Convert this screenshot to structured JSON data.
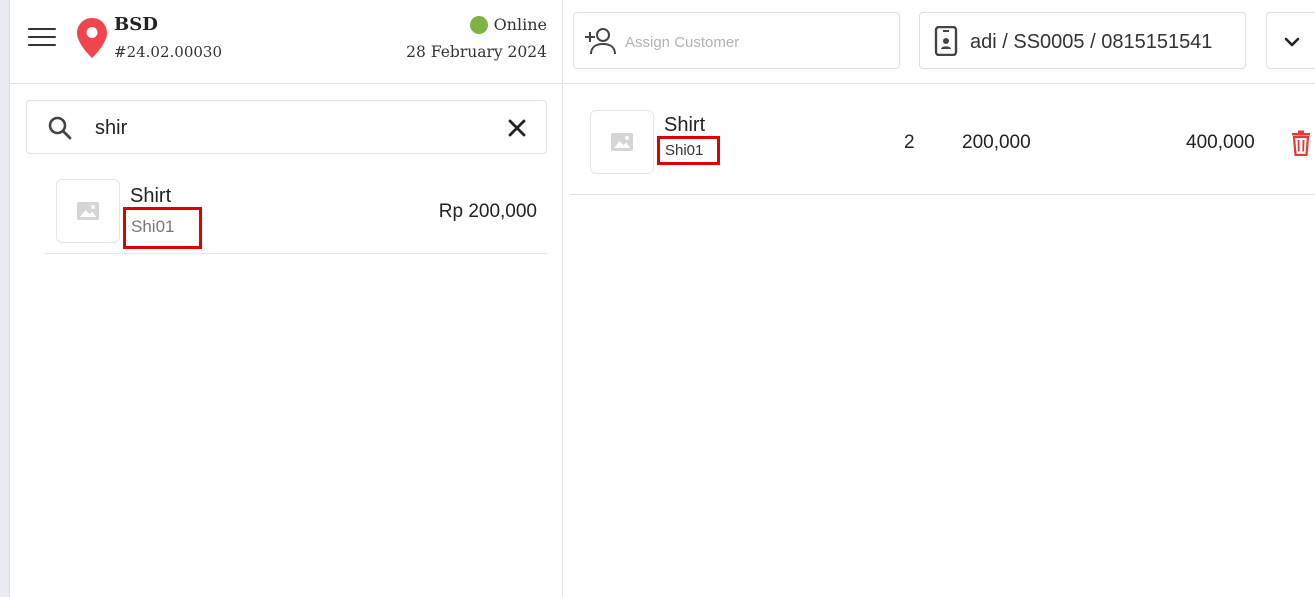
{
  "header": {
    "store_name": "BSD",
    "transaction_number": "#24.02.00030",
    "status": "Online",
    "status_color": "#7cb342",
    "date": "28 February 2024"
  },
  "search": {
    "value": "shir"
  },
  "products": [
    {
      "name": "Shirt",
      "sku": "Shi01",
      "price": "Rp 200,000"
    }
  ],
  "customer": {
    "placeholder": "Assign Customer"
  },
  "employee": {
    "label": "adi / SS0005 / 0815151541"
  },
  "cart": {
    "items": [
      {
        "name": "Shirt",
        "sku": "Shi01",
        "qty": "2",
        "unit_price": "200,000",
        "total": "400,000"
      }
    ]
  },
  "colors": {
    "pin": "#f0444f",
    "highlight": "#e00000",
    "trash": "#e53935"
  },
  "icons": [
    "menu-icon",
    "location-pin-icon",
    "search-icon",
    "close-icon",
    "image-placeholder-icon",
    "add-person-icon",
    "phone-icon",
    "chevron-down-icon",
    "trash-icon"
  ]
}
